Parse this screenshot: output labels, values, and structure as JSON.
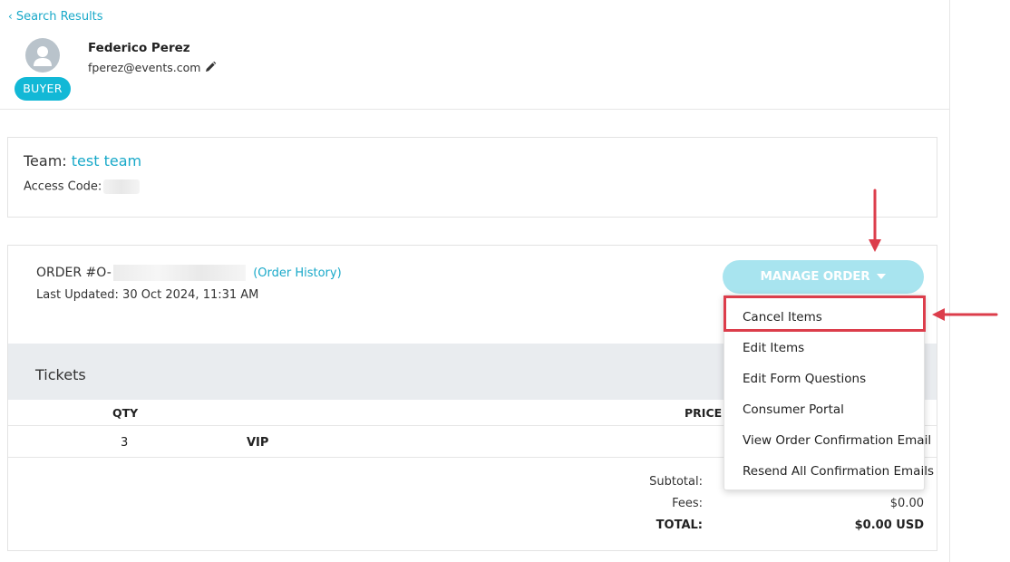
{
  "nav": {
    "back_label": "Search Results"
  },
  "user": {
    "name": "Federico Perez",
    "email": "fperez@events.com",
    "role_badge": "BUYER"
  },
  "team": {
    "label": "Team:",
    "name": "test team",
    "access_code_label": "Access Code:"
  },
  "order": {
    "number_prefix": "ORDER #O-",
    "history_link": "(Order History)",
    "last_updated": "Last Updated: 30 Oct 2024, 11:31 AM",
    "manage_button": "MANAGE ORDER"
  },
  "tickets": {
    "title": "Tickets",
    "columns": {
      "qty": "QTY",
      "price": "PRICE I"
    },
    "rows": [
      {
        "qty": "3",
        "name": "VIP"
      }
    ]
  },
  "summary": {
    "subtotal_label": "Subtotal:",
    "fees_label": "Fees:",
    "fees_value": "$0.00",
    "total_label": "TOTAL:",
    "total_value": "$0.00 USD"
  },
  "manage_menu": {
    "items": [
      "Cancel Items",
      "Edit Items",
      "Edit Form Questions",
      "Consumer Portal",
      "View Order Confirmation Email",
      "Resend All Confirmation Emails"
    ]
  },
  "colors": {
    "accent": "#19a9c9",
    "badge": "#12b8d6",
    "manage_button": "#a8e4ef",
    "annotation": "#dc3d4b",
    "section_bg": "#e9ecef"
  }
}
